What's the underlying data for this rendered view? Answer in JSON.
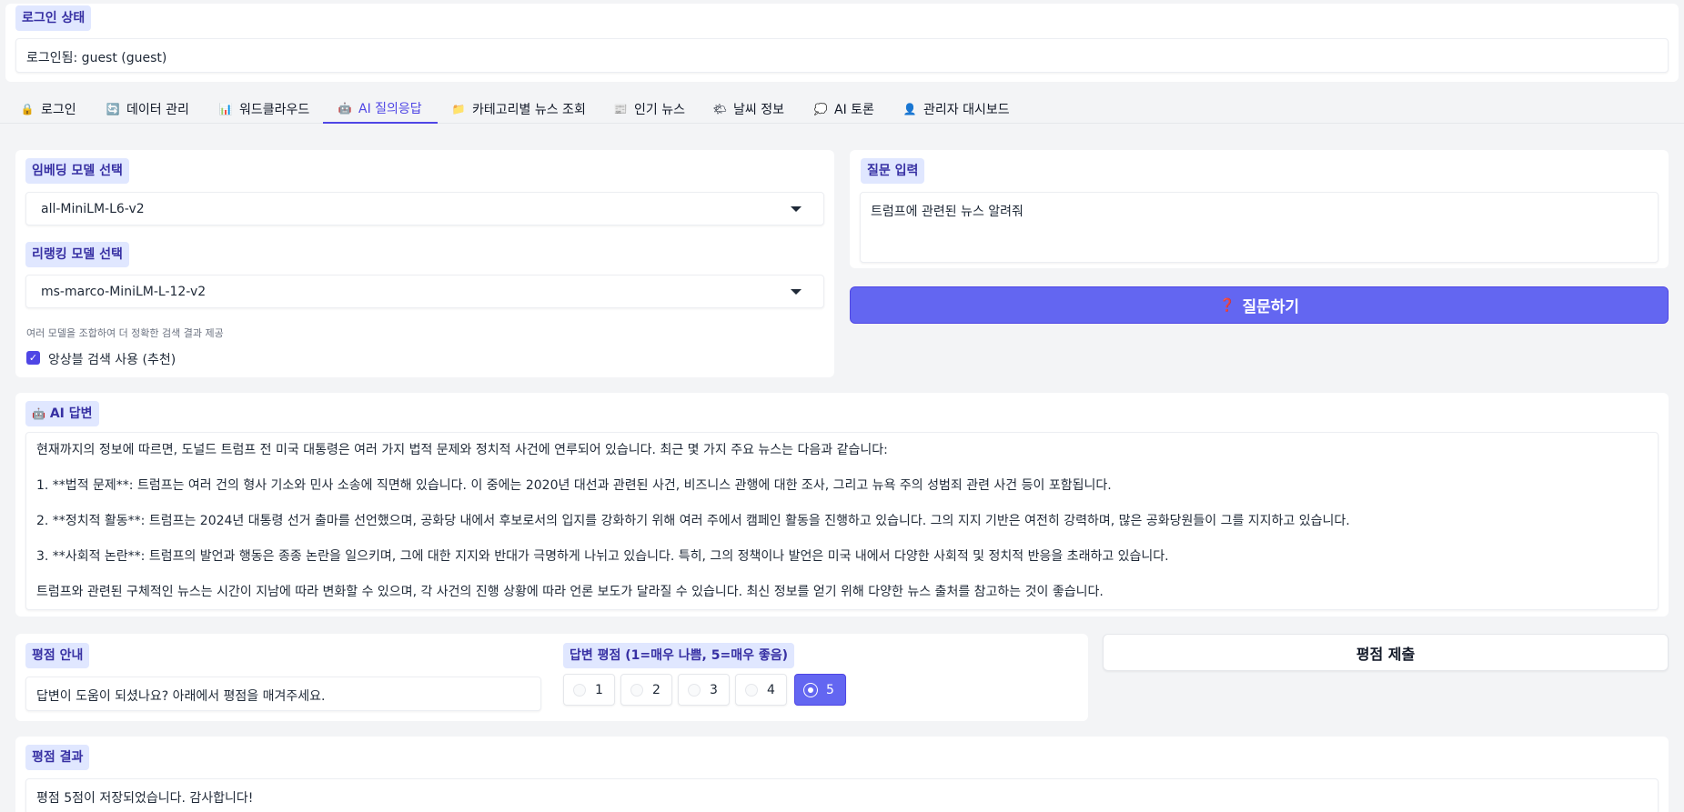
{
  "login_status": {
    "label": "로그인 상태",
    "value": "로그인됨: guest (guest)"
  },
  "tabs": [
    {
      "label": "로그인",
      "icon": "lock-icon",
      "glyph": "🔒"
    },
    {
      "label": "데이터 관리",
      "icon": "refresh-icon",
      "glyph": "🔄"
    },
    {
      "label": "워드클라우드",
      "icon": "bar-chart-icon",
      "glyph": "📊"
    },
    {
      "label": "AI 질의응답",
      "icon": "robot-icon",
      "glyph": "🤖"
    },
    {
      "label": "카테고리별 뉴스 조회",
      "icon": "folder-icon",
      "glyph": "📁"
    },
    {
      "label": "인기 뉴스",
      "icon": "newspaper-icon",
      "glyph": "📰"
    },
    {
      "label": "날씨 정보",
      "icon": "weather-icon",
      "glyph": "🌤"
    },
    {
      "label": "AI 토론",
      "icon": "speech-bubble-icon",
      "glyph": "💭"
    },
    {
      "label": "관리자 대시보드",
      "icon": "admin-icon",
      "glyph": "👤"
    }
  ],
  "active_tab": "AI 질의응답",
  "settings": {
    "embedding_label": "임베딩 모델 선택",
    "embedding_value": "all-MiniLM-L6-v2",
    "reranking_label": "리랭킹 모델 선택",
    "reranking_value": "ms-marco-MiniLM-L-12-v2",
    "ensemble_hint": "여러 모델을 조합하여 더 정확한 검색 결과 제공",
    "ensemble_label": "앙상블 검색 사용 (추천)",
    "ensemble_checked": true
  },
  "question": {
    "label": "질문 입력",
    "value": "트럼프에 관련된 뉴스 알려줘",
    "button_label": "질문하기",
    "button_icon": "question-icon",
    "button_glyph": "❓"
  },
  "answer": {
    "label": "AI 답변",
    "icon": "robot-icon",
    "glyph": "🤖",
    "paragraphs": [
      "현재까지의 정보에 따르면, 도널드 트럼프 전 미국 대통령은 여러 가지 법적 문제와 정치적 사건에 연루되어 있습니다. 최근 몇 가지 주요 뉴스는 다음과 같습니다:",
      "1. **법적 문제**: 트럼프는 여러 건의 형사 기소와 민사 소송에 직면해 있습니다. 이 중에는 2020년 대선과 관련된 사건, 비즈니스 관행에 대한 조사, 그리고 뉴욕 주의 성범죄 관련 사건 등이 포함됩니다.",
      "2. **정치적 활동**: 트럼프는 2024년 대통령 선거 출마를 선언했으며, 공화당 내에서 후보로서의 입지를 강화하기 위해 여러 주에서 캠페인 활동을 진행하고 있습니다. 그의 지지 기반은 여전히 강력하며, 많은 공화당원들이 그를 지지하고 있습니다.",
      "3. **사회적 논란**: 트럼프의 발언과 행동은 종종 논란을 일으키며, 그에 대한 지지와 반대가 극명하게 나뉘고 있습니다. 특히, 그의 정책이나 발언은 미국 내에서 다양한 사회적 및 정치적 반응을 초래하고 있습니다.",
      "트럼프와 관련된 구체적인 뉴스는 시간이 지남에 따라 변화할 수 있으며, 각 사건의 진행 상황에 따라 언론 보도가 달라질 수 있습니다. 최신 정보를 얻기 위해 다양한 뉴스 출처를 참고하는 것이 좋습니다."
    ]
  },
  "rating": {
    "guide_label": "평점 안내",
    "guide_text": "답변이 도움이 되셨나요? 아래에서 평점을 매겨주세요.",
    "score_label": "답변 평점 (1=매우 나쁨, 5=매우 좋음)",
    "options": [
      "1",
      "2",
      "3",
      "4",
      "5"
    ],
    "selected": "5",
    "submit_label": "평점 제출"
  },
  "result": {
    "label": "평점 결과",
    "text": "평점 5점이 저장되었습니다. 감사합니다!"
  },
  "colors": {
    "accent": "#6366f1",
    "accent_dark": "#4f46e5",
    "chip_bg": "#e0e7ff",
    "chip_text": "#3730a3",
    "page_bg": "#f3f4f6"
  }
}
